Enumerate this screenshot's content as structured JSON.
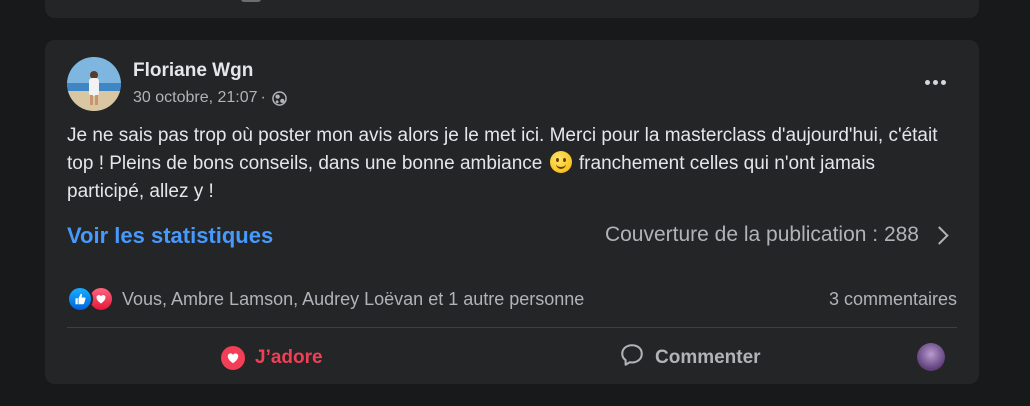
{
  "post": {
    "author": "Floriane Wgn",
    "date": "30 octobre, 21:07",
    "separator": "·",
    "privacy_icon": "globe-icon",
    "text_parts": [
      "Je ne sais pas trop où poster mon avis alors je le met ici. Merci pour la masterclass d'aujourd'hui, c'était top ! Pleins de bons conseils, dans une bonne ambiance",
      " franchement celles qui n'ont jamais participé, allez y !"
    ],
    "emoji": "slightly-smiling-face"
  },
  "insights": {
    "link_label": "Voir les statistiques",
    "coverage_label": "Couverture de la publication : 288"
  },
  "reactions": {
    "icons": [
      "like-icon",
      "love-icon"
    ],
    "summary": "Vous, Ambre Lamson, Audrey Loëvan et 1 autre personne",
    "comments": "3 commentaires"
  },
  "actions": {
    "love_label": "J’adore",
    "comment_label": "Commenter"
  },
  "colors": {
    "background": "#18191a",
    "card": "#242526",
    "link": "#4599ff",
    "love": "#f33e58",
    "secondary_text": "#b0b3b8"
  }
}
